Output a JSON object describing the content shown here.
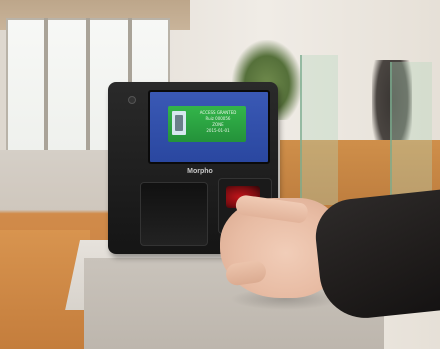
{
  "device": {
    "brand": "Morpho",
    "screen": {
      "lines": [
        "ACCESS GRANTED",
        "Ruiz 000056",
        "ZONE",
        "2015-01-01"
      ]
    }
  },
  "colors": {
    "screen_background": "#2a47a0",
    "status_panel": "#24923a",
    "sensor_light": "#c0141a",
    "orange_panel": "#c47d3c"
  },
  "icons": {
    "status_icon": "door-icon"
  }
}
